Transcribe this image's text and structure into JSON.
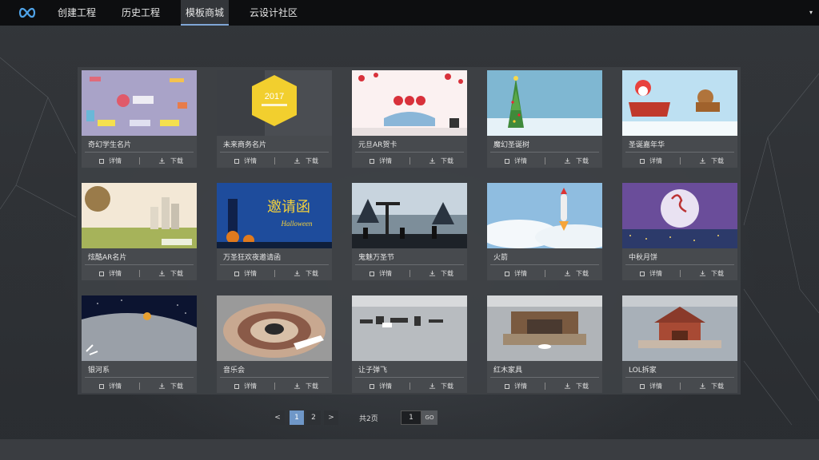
{
  "nav": {
    "logo_icon": "infinity-logo-icon",
    "items": [
      {
        "label": "创建工程",
        "active": false
      },
      {
        "label": "历史工程",
        "active": false
      },
      {
        "label": "模板商城",
        "active": true
      },
      {
        "label": "云设计社区",
        "active": false
      }
    ],
    "menu_icon": "caret-down-icon",
    "caret_glyph": "▾"
  },
  "cards": [
    {
      "title": "奇幻学生名片"
    },
    {
      "title": "未来商务名片"
    },
    {
      "title": "元旦AR贺卡"
    },
    {
      "title": "魔幻圣诞树"
    },
    {
      "title": "圣诞嘉年华"
    },
    {
      "title": "炫酷AR名片"
    },
    {
      "title": "万圣狂欢夜邀请函"
    },
    {
      "title": "鬼魅万圣节"
    },
    {
      "title": "火箭"
    },
    {
      "title": "中秋月饼"
    },
    {
      "title": "银河系"
    },
    {
      "title": "音乐会"
    },
    {
      "title": "让子弹飞"
    },
    {
      "title": "红木家具"
    },
    {
      "title": "LOL拆家"
    }
  ],
  "card_actions": {
    "detail": "详情",
    "download": "下载"
  },
  "thumb_text": {
    "card2_year": "2017",
    "card7_banner": "邀请函",
    "card7_sub": "Halloween"
  },
  "pagination": {
    "prev": "<",
    "pages": [
      "1",
      "2"
    ],
    "current": "1",
    "next": ">",
    "total": "共2页",
    "input_value": "1",
    "go": "GO"
  },
  "colors": {
    "topbar": "#0d0e10",
    "active_underline": "#7fa6d6",
    "page_active": "#6f97c8"
  }
}
